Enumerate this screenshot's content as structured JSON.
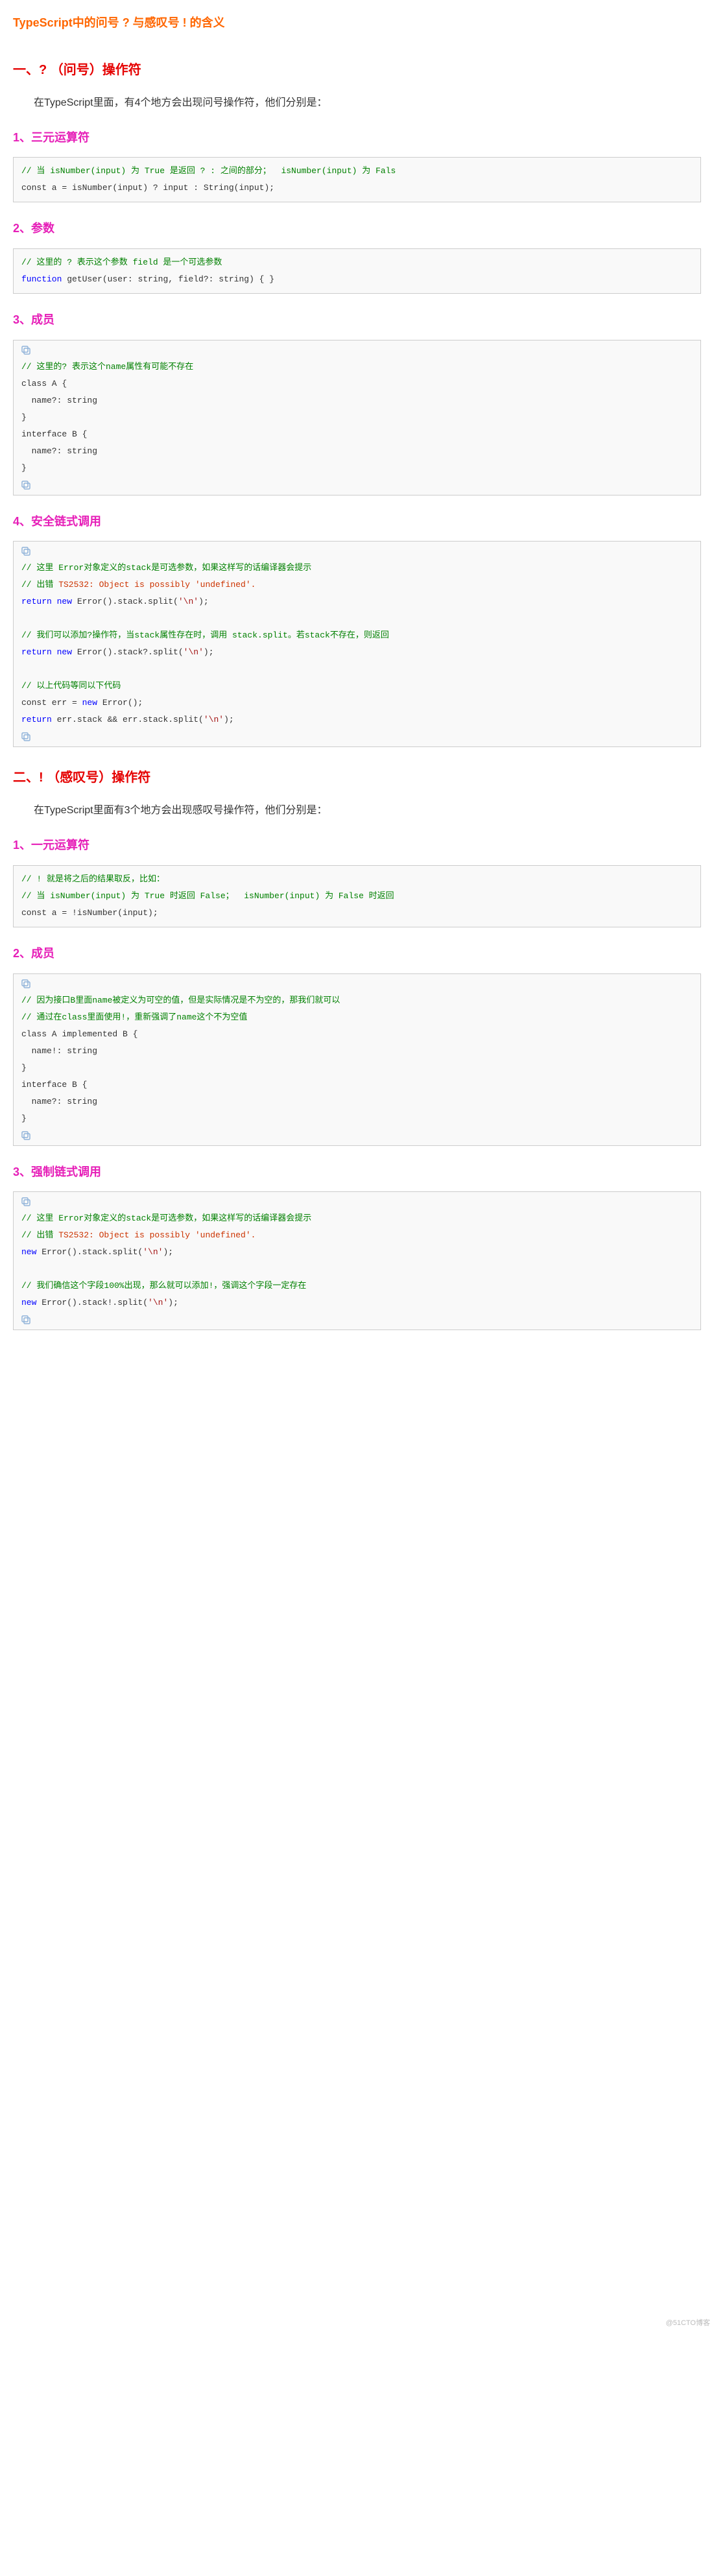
{
  "title": "TypeScript中的问号 ? 与感叹号 ! 的含义",
  "sections": {
    "s1": {
      "heading": "一、?  （问号）操作符",
      "lead": "在TypeScript里面，有4个地方会出现问号操作符，他们分别是：",
      "sub1": {
        "heading": "1、三元运算符"
      },
      "sub2": {
        "heading": "2、参数"
      },
      "sub3": {
        "heading": "3、成员"
      },
      "sub4": {
        "heading": "4、安全链式调用"
      }
    },
    "s2": {
      "heading": "二、!  （感叹号）操作符",
      "lead": "在TypeScript里面有3个地方会出现感叹号操作符，他们分别是：",
      "sub1": {
        "heading": "1、一元运算符"
      },
      "sub2": {
        "heading": "2、成员"
      },
      "sub3": {
        "heading": "3、强制链式调用"
      }
    }
  },
  "code": {
    "ternary_c1": "// 当 isNumber(input) 为 True 是返回 ? : 之间的部分；  isNumber(input) 为 Fals",
    "ternary_l1": "const a = isNumber(input) ? input : String(input);",
    "param_c1": "// 这里的 ? 表示这个参数 field 是一个可选参数",
    "param_l1a": "function",
    "param_l1b": " getUser(user: string, field?: string) { }",
    "member_c1": "// 这里的? 表示这个name属性有可能不存在",
    "member_l1": "class A {",
    "member_l2": "  name?: string",
    "member_l3": "}",
    "member_l4": "",
    "member_l5": "interface B {",
    "member_l6": "  name?: string",
    "member_l7": "}",
    "safe_c1": "// 这里 Error对象定义的stack是可选参数，如果这样写的话编译器会提示",
    "safe_c2a": "// 出错",
    "safe_c2b": " TS2532: Object is possibly 'undefined'.",
    "safe_l1a": "return",
    "safe_l1b": " new",
    "safe_l1c": " Error().stack.split(",
    "safe_l1d": "'\\n'",
    "safe_l1e": ");",
    "safe_c3": "// 我们可以添加?操作符，当stack属性存在时，调用 stack.split。若stack不存在，则返回",
    "safe_l2a": "return",
    "safe_l2b": " new",
    "safe_l2c": " Error().stack?.split(",
    "safe_l2d": "'\\n'",
    "safe_l2e": ");",
    "safe_c4": "// 以上代码等同以下代码",
    "safe_l3a": "const err = ",
    "safe_l3b": "new",
    "safe_l3c": " Error();",
    "safe_l4a": "return",
    "safe_l4b": " err.stack && err.stack.split(",
    "safe_l4c": "'\\n'",
    "safe_l4d": ");",
    "unary_c1": "// ! 就是将之后的结果取反，比如：",
    "unary_c2": "// 当 isNumber(input) 为 True 时返回 False；  isNumber(input) 为 False 时返回",
    "unary_l1": "const a = !isNumber(input);",
    "bang_member_c1": "// 因为接口B里面name被定义为可空的值，但是实际情况是不为空的，那我们就可以",
    "bang_member_c2": "// 通过在class里面使用!，重新强调了name这个不为空值",
    "bang_member_l1": "class A implemented B {",
    "bang_member_l2": "  name!: string",
    "bang_member_l3": "}",
    "bang_member_l4": "",
    "bang_member_l5": "interface B {",
    "bang_member_l6": "  name?: string",
    "bang_member_l7": "}",
    "force_c1": "// 这里 Error对象定义的stack是可选参数，如果这样写的话编译器会提示",
    "force_c2a": "// 出错",
    "force_c2b": " TS2532: Object is possibly 'undefined'.",
    "force_l1a": "new",
    "force_l1b": " Error().stack.split(",
    "force_l1c": "'\\n'",
    "force_l1d": ");",
    "force_c3": "// 我们确信这个字段100%出现，那么就可以添加!，强调这个字段一定存在",
    "force_l2a": "new",
    "force_l2b": " Error().stack!.split(",
    "force_l2c": "'\\n'",
    "force_l2d": ");"
  },
  "watermark": "@51CTO博客"
}
